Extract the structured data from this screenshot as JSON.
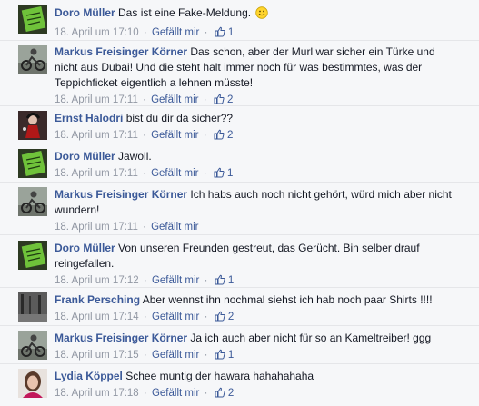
{
  "colors": {
    "link": "#3b5998",
    "meta": "#9197a3",
    "background": "#f6f7f9"
  },
  "comments": [
    {
      "author": "Doro Müller",
      "text": "Das ist eine Fake-Meldung.",
      "emoticon": "smiley-icon",
      "date": "18. April um 17:10",
      "like_label": "Gefällt mir",
      "likes": "1",
      "avatar": "green-sign-avatar"
    },
    {
      "author": "Markus Freisinger Körner",
      "text": "Das schon, aber der Murl war sicher ein Türke und nicht aus Dubai! Und die steht halt immer noch für was bestimmtes, was der Teppichficket eigentlich a lehnen müsste!",
      "date": "18. April um 17:11",
      "like_label": "Gefällt mir",
      "likes": "2",
      "avatar": "motorbike-avatar"
    },
    {
      "author": "Ernst Halodri",
      "text": "bist du dir da sicher??",
      "date": "18. April um 17:11",
      "like_label": "Gefällt mir",
      "likes": "2",
      "avatar": "dark-figure-avatar"
    },
    {
      "author": "Doro Müller",
      "text": "Jawoll.",
      "date": "18. April um 17:11",
      "like_label": "Gefällt mir",
      "likes": "1",
      "avatar": "green-sign-avatar"
    },
    {
      "author": "Markus Freisinger Körner",
      "text": "Ich habs auch noch nicht gehört, würd mich aber nicht wundern!",
      "date": "18. April um 17:11",
      "like_label": "Gefällt mir",
      "likes": "",
      "avatar": "motorbike-avatar"
    },
    {
      "author": "Doro Müller",
      "text": "Von unseren Freunden gestreut, das Gerücht. Bin selber drauf reingefallen.",
      "date": "18. April um 17:12",
      "like_label": "Gefällt mir",
      "likes": "1",
      "avatar": "green-sign-avatar"
    },
    {
      "author": "Frank Persching",
      "text": "Aber wennst ihn nochmal siehst ich hab noch paar Shirts !!!!",
      "date": "18. April um 17:14",
      "like_label": "Gefällt mir",
      "likes": "2",
      "avatar": "grey-photo-avatar"
    },
    {
      "author": "Markus Freisinger Körner",
      "text": "Ja ich auch aber nicht für so an Kameltreiber! ggg",
      "date": "18. April um 17:15",
      "like_label": "Gefällt mir",
      "likes": "1",
      "avatar": "motorbike-avatar"
    },
    {
      "author": "Lydia Köppel",
      "text": "Schee muntig der hawara hahahahaha",
      "date": "18. April um 17:18",
      "like_label": "Gefällt mir",
      "likes": "2",
      "avatar": "portrait-avatar"
    }
  ]
}
